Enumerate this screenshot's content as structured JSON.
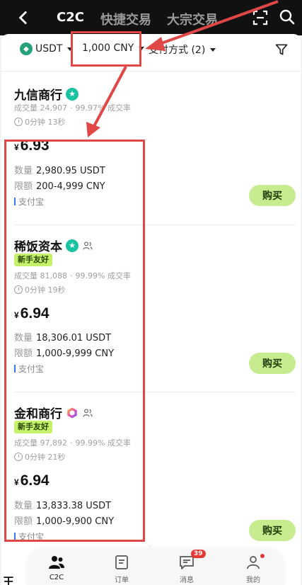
{
  "header": {
    "tabs": [
      {
        "label": "C2C",
        "active": true
      },
      {
        "label": "快捷交易",
        "active": false
      },
      {
        "label": "大宗交易",
        "active": false
      }
    ]
  },
  "filters": {
    "coin": "USDT",
    "amount": "1,000 CNY",
    "payment": "支付方式 (2)"
  },
  "listings": [
    {
      "merchant": "九信商行",
      "badge": "verified-icon",
      "newbie": null,
      "volume_label": "成交量",
      "volume": "24,907",
      "rate": "99.97%",
      "rate_label": "成交率",
      "time": "0分钟 13秒",
      "currency_symbol": "¥",
      "price": "6.93",
      "qty_label": "数量",
      "qty": "2,980.95 USDT",
      "limit_label": "限额",
      "limit": "200-4,999 CNY",
      "payment": "支付宝",
      "buy_label": "购买"
    },
    {
      "merchant": "稀饭资本",
      "badge": "verified-icon",
      "newbie": "新手友好",
      "volume_label": "成交量",
      "volume": "81,088",
      "rate": "99.99%",
      "rate_label": "成交率",
      "time": "0分钟 19秒",
      "currency_symbol": "¥",
      "price": "6.94",
      "qty_label": "数量",
      "qty": "18,306.01 USDT",
      "limit_label": "限额",
      "limit": "1,000-9,999 CNY",
      "payment": "支付宝",
      "buy_label": "购买"
    },
    {
      "merchant": "金和商行",
      "badge": "hexagon-badge-icon",
      "newbie": "新手友好",
      "volume_label": "成交量",
      "volume": "97,892",
      "rate": "99.99%",
      "rate_label": "成交率",
      "time": "0分钟 21秒",
      "currency_symbol": "¥",
      "price": "6.94",
      "qty_label": "数量",
      "qty": "13,833.38 USDT",
      "limit_label": "限额",
      "limit": "1,000-9,900 CNY",
      "payment": "支付宝",
      "buy_label": "购买"
    }
  ],
  "partial_next_merchant": "王",
  "bottom_nav": [
    {
      "label": "C2C",
      "icon": "users-icon",
      "active": true
    },
    {
      "label": "订单",
      "icon": "order-icon",
      "active": false
    },
    {
      "label": "消息",
      "icon": "message-icon",
      "active": false,
      "badge": "39"
    },
    {
      "label": "我的",
      "icon": "profile-icon",
      "active": false,
      "dot": true
    }
  ],
  "colors": {
    "header_bg": "#111111",
    "buy_button": "#c7ec8f",
    "newbie_tag": "#c6f26b",
    "annotation": "#e04848",
    "payment_bar": "#3b77f0"
  }
}
